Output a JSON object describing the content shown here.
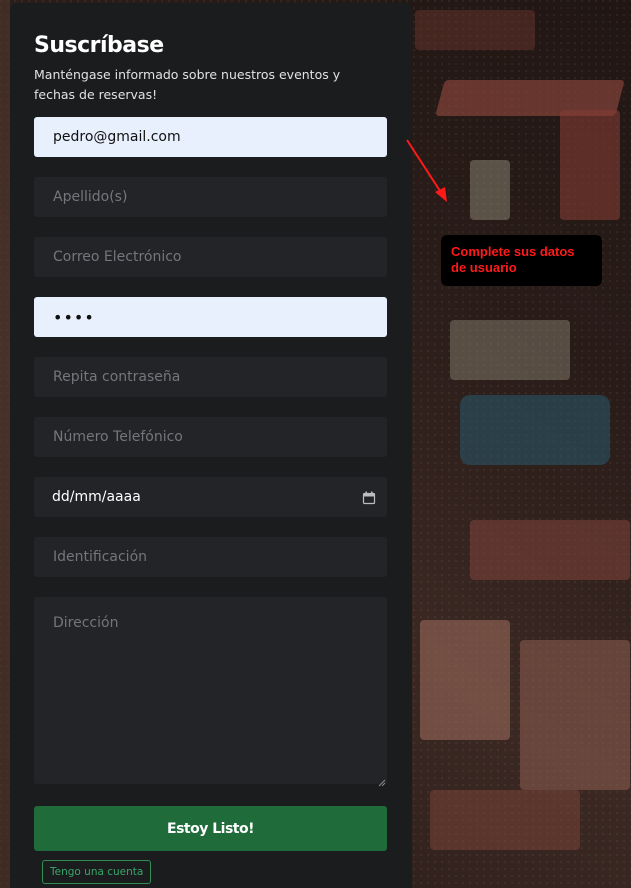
{
  "form": {
    "title": "Suscríbase",
    "subtitle": "Manténgase informado sobre nuestros eventos y fechas de reservas!",
    "email_value": "pedro@gmail.com",
    "surname_placeholder": "Apellido(s)",
    "email_placeholder": "Correo Electrónico",
    "password_value": "••••",
    "repeat_password_placeholder": "Repita contraseña",
    "phone_placeholder": "Número Telefónico",
    "date_format": "dd/mm/aaaa",
    "id_placeholder": "Identificación",
    "address_placeholder": "Dirección",
    "submit_label": "Estoy Listo!",
    "account_link_label": "Tengo una cuenta"
  },
  "annotation": {
    "tooltip_text": "Complete sus datos de usuario",
    "tooltip_color": "#ff1a1a",
    "arrow_color": "#ff1a1a"
  },
  "icons": {
    "date": "calendar-icon",
    "arrow": "arrow-icon"
  },
  "colors": {
    "card_background": "#1b1c1e",
    "field_background": "#232427",
    "autofill_background": "#e8f0fe",
    "submit_background": "#1f6b3a",
    "link_border": "#2f8f55"
  }
}
